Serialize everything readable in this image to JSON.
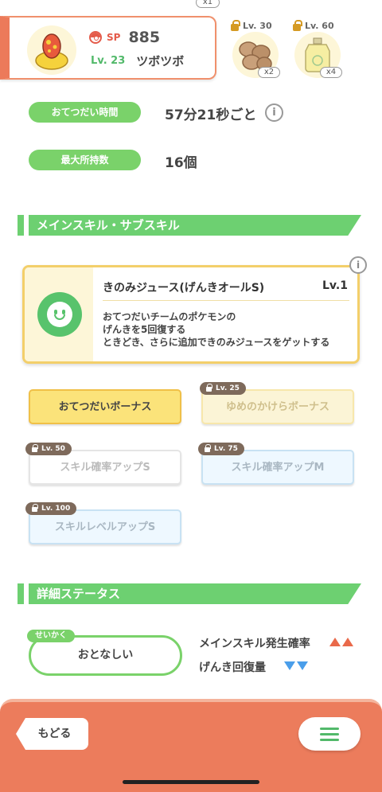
{
  "header": {
    "sp_label": "SP",
    "sp_value": "885",
    "level": "Lv. 23",
    "pokemon_name": "ツボツボ",
    "top_count": "x1"
  },
  "ingredients": [
    {
      "level": "Lv. 30",
      "count": "x2",
      "icon": "nuts-icon"
    },
    {
      "level": "Lv. 60",
      "count": "x4",
      "icon": "honey-jar-icon"
    }
  ],
  "info": {
    "help_time_label": "おてつだい時間",
    "help_time_value": "57分21秒ごと",
    "max_carry_label": "最大所持数",
    "max_carry_value": "16個"
  },
  "sections": {
    "skills": "メインスキル・サブスキル",
    "details": "詳細ステータス"
  },
  "main_skill": {
    "name": "きのみジュース(げんきオールS)",
    "level": "Lv.1",
    "desc_line1": "おてつだいチームのポケモンの",
    "desc_line2": "げんきを5回復する",
    "desc_line3": "ときどき、さらに追加できのみジュースをゲットする"
  },
  "sub_skills": [
    {
      "label": "おてつだいボーナス",
      "unlock": ""
    },
    {
      "label": "ゆめのかけらボーナス",
      "unlock": "Lv. 25"
    },
    {
      "label": "スキル確率アップS",
      "unlock": "Lv. 50"
    },
    {
      "label": "スキル確率アップM",
      "unlock": "Lv. 75"
    },
    {
      "label": "スキルレベルアップS",
      "unlock": "Lv. 100"
    }
  ],
  "nature": {
    "tag": "せいかく",
    "value": "おとなしい",
    "up_effect": "メインスキル発生確率",
    "down_effect": "げんき回復量"
  },
  "bottom": {
    "back_label": "もどる"
  },
  "colors": {
    "accent_green": "#6dd071",
    "accent_orange": "#ec7c5c",
    "gold": "#fbe37a",
    "up": "#e9694a",
    "down": "#4a9eea"
  }
}
